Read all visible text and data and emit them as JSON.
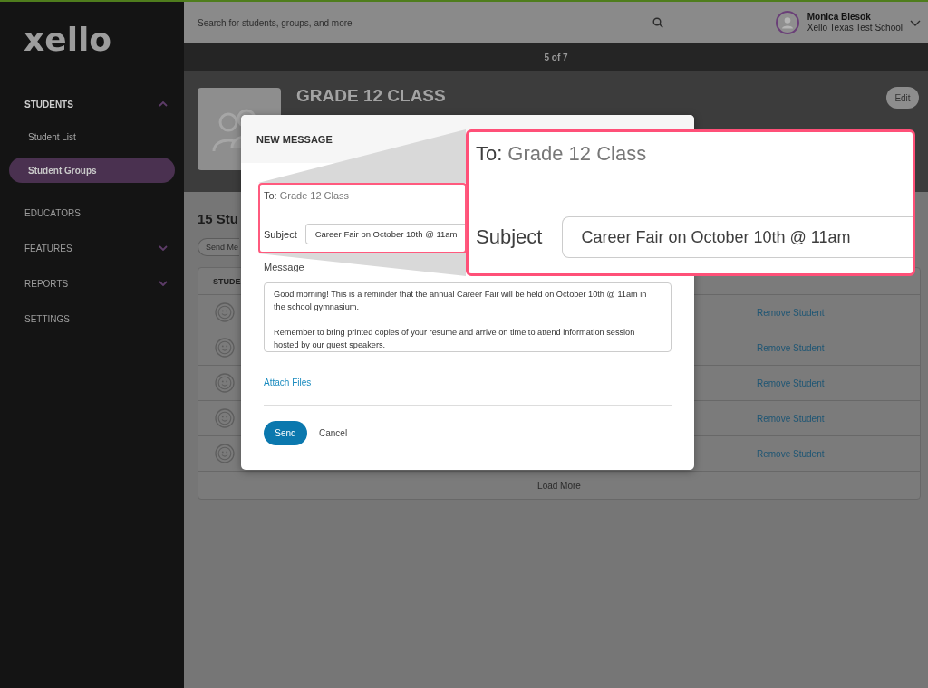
{
  "sidebar": {
    "logo": "xello",
    "items": [
      {
        "label": "STUDENTS",
        "kind": "group",
        "expanded": true,
        "children": [
          {
            "label": "Student List",
            "selected": false
          },
          {
            "label": "Student Groups",
            "selected": true
          }
        ]
      },
      {
        "label": "EDUCATORS",
        "kind": "link"
      },
      {
        "label": "FEATURES",
        "kind": "group",
        "expanded": false
      },
      {
        "label": "REPORTS",
        "kind": "group",
        "expanded": false
      },
      {
        "label": "SETTINGS",
        "kind": "link"
      }
    ]
  },
  "header": {
    "search": {
      "placeholder": "Search for students, groups, and more"
    },
    "user": {
      "name": "Monica Biesok",
      "school": "Xello Texas Test School"
    }
  },
  "pager": "5 of 7",
  "group": {
    "title": "GRADE 12 CLASS",
    "edit_button": "Edit",
    "count": "15 Stu",
    "send_button": "Send Me",
    "table": {
      "columns": [
        "STUDE"
      ],
      "rows": [
        {
          "action": "Remove Student"
        },
        {
          "action": "Remove Student"
        },
        {
          "action": "Remove Student"
        },
        {
          "action": "Remove Student"
        },
        {
          "action": "Remove Student"
        }
      ],
      "load_more": "Load More"
    }
  },
  "modal": {
    "title": "NEW MESSAGE",
    "to_label": "To:",
    "to_value": "Grade 12 Class",
    "subject_label": "Subject",
    "subject_value": "Career Fair on October 10th @ 11am",
    "message_label": "Message",
    "message_value": "Good morning! This is a reminder that the annual Career Fair will be held on October 10th @ 11am in the school gymnasium.\n\nRemember to bring printed copies of your resume and arrive on time to attend information session hosted by our guest speakers.",
    "attach_link": "Attach Files",
    "buttons": [
      {
        "label": "Send",
        "kind": "primary"
      },
      {
        "label": "Cancel",
        "kind": "secondary"
      }
    ]
  },
  "callout": {
    "to_label": "To:",
    "to_value": "Grade 12 Class",
    "subject_label": "Subject",
    "subject_value": "Career Fair on October 10th @ 11am"
  }
}
